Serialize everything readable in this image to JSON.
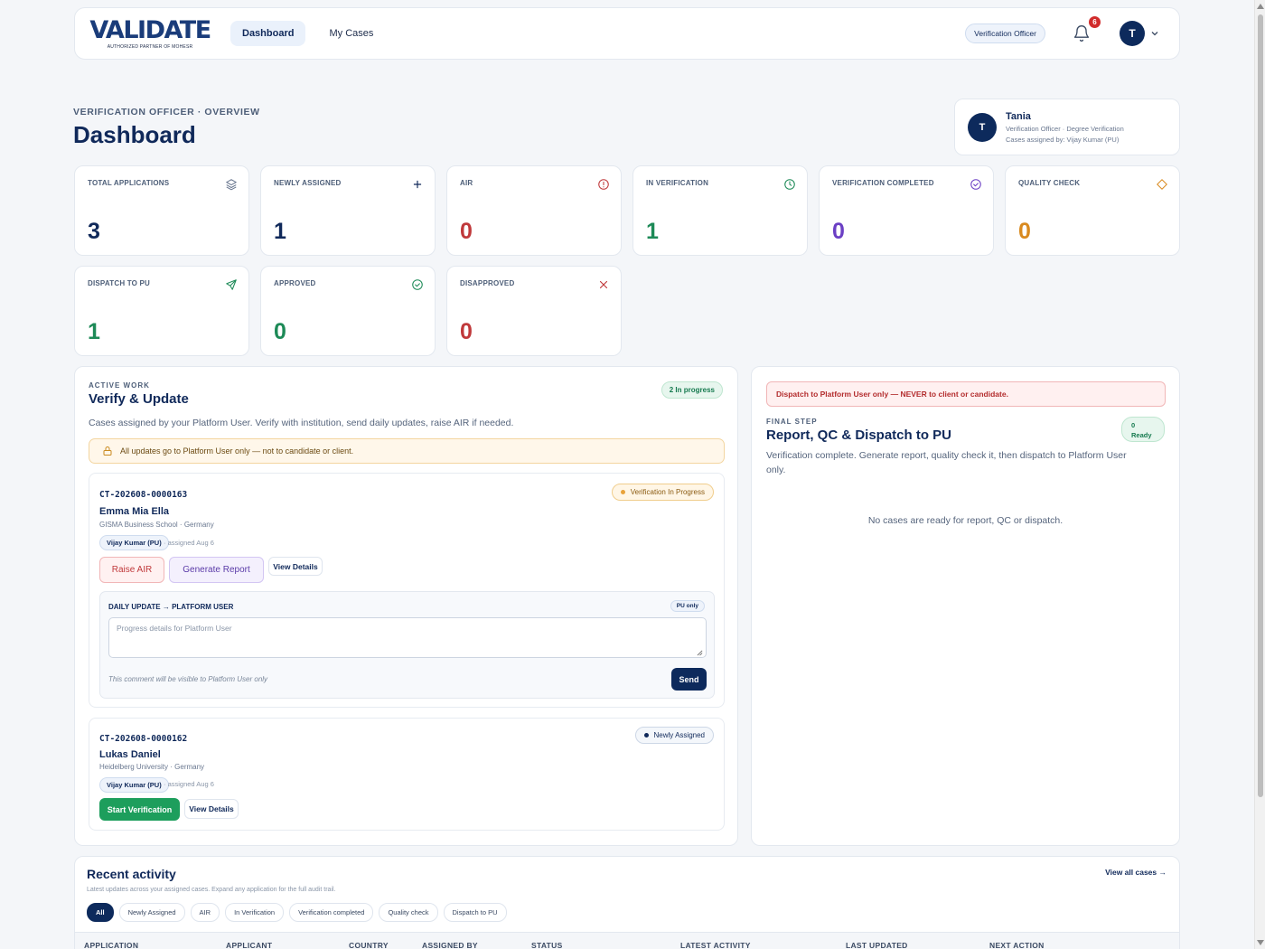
{
  "nav": {
    "logo_text": "VALIDATE",
    "logo_sub": "AUTHORIZED PARTNER OF MOHESR",
    "items": [
      {
        "label": "Dashboard",
        "active": true
      },
      {
        "label": "My Cases",
        "active": false
      }
    ],
    "role": "Verification Officer",
    "notifications": "6",
    "avatar_initial": "T"
  },
  "header": {
    "eyebrow": "VERIFICATION OFFICER · OVERVIEW",
    "title": "Dashboard"
  },
  "user_card": {
    "initial": "T",
    "name": "Tania",
    "role_line": "Verification Officer · Degree Verification",
    "assigned_line": "Cases assigned by: Vijay Kumar (PU)"
  },
  "stats": [
    {
      "label": "TOTAL APPLICATIONS",
      "value": "3",
      "icon": "layers-icon",
      "color": "#10295a"
    },
    {
      "label": "NEWLY ASSIGNED",
      "value": "1",
      "icon": "plus-icon",
      "color": "#10295a"
    },
    {
      "label": "AIR",
      "value": "0",
      "icon": "alert-circle-icon",
      "color": "#c0393b"
    },
    {
      "label": "IN VERIFICATION",
      "value": "1",
      "icon": "clock-icon",
      "color": "#1d8a57"
    },
    {
      "label": "VERIFICATION COMPLETED",
      "value": "0",
      "icon": "check-circle-icon",
      "color": "#6b3fc4"
    },
    {
      "label": "QUALITY CHECK",
      "value": "0",
      "icon": "diamond-icon",
      "color": "#d98a1f"
    },
    {
      "label": "DISPATCH TO PU",
      "value": "1",
      "icon": "send-icon",
      "color": "#1d8a57"
    },
    {
      "label": "APPROVED",
      "value": "0",
      "icon": "check-circle-icon",
      "color": "#1d8a57"
    },
    {
      "label": "DISAPPROVED",
      "value": "0",
      "icon": "x-icon",
      "color": "#c0393b"
    }
  ],
  "active_work": {
    "eyebrow": "ACTIVE WORK",
    "title": "Verify & Update",
    "badge": "2 In progress",
    "description": "Cases assigned by your Platform User. Verify with institution, send daily updates, raise AIR if needed.",
    "notice": "All updates go to Platform User only — not to candidate or client.",
    "cases": [
      {
        "id": "CT-202608-0000163",
        "name": "Emma Mia Ella",
        "school": "GISMA Business School · Germany",
        "pu": "Vijay Kumar (PU)",
        "assigned": "· assigned Aug 6",
        "status": "Verification In Progress",
        "btn_air": "Raise AIR",
        "btn_report": "Generate Report",
        "btn_details": "View Details",
        "daily_title": "DAILY UPDATE → PLATFORM USER",
        "pu_only": "PU only",
        "daily_placeholder": "Progress details for Platform User",
        "daily_hint": "This comment will be visible to Platform User only",
        "btn_send": "Send"
      },
      {
        "id": "CT-202608-0000162",
        "name": "Lukas Daniel",
        "school": "Heidelberg University · Germany",
        "pu": "Vijay Kumar (PU)",
        "assigned": "· assigned Aug 6",
        "status": "Newly Assigned",
        "btn_start": "Start Verification",
        "btn_details": "View Details"
      }
    ]
  },
  "final_step": {
    "notice": "Dispatch to Platform User only — NEVER to client or candidate.",
    "eyebrow": "FINAL STEP",
    "title": "Report, QC & Dispatch to PU",
    "badge_count": "0",
    "badge_label": "Ready",
    "description": "Verification complete. Generate report, quality check it, then dispatch to Platform User only.",
    "empty": "No cases are ready for report, QC or dispatch."
  },
  "recent": {
    "title": "Recent activity",
    "subtitle": "Latest updates across your assigned cases. Expand any application for the full audit trail.",
    "link": "View all cases →",
    "filters": [
      "All",
      "Newly Assigned",
      "AIR",
      "In Verification",
      "Verification completed",
      "Quality check",
      "Dispatch to PU"
    ],
    "columns": [
      "APPLICATION",
      "APPLICANT",
      "COUNTRY",
      "ASSIGNED BY",
      "STATUS",
      "LATEST ACTIVITY",
      "LAST UPDATED",
      "NEXT ACTION"
    ]
  }
}
